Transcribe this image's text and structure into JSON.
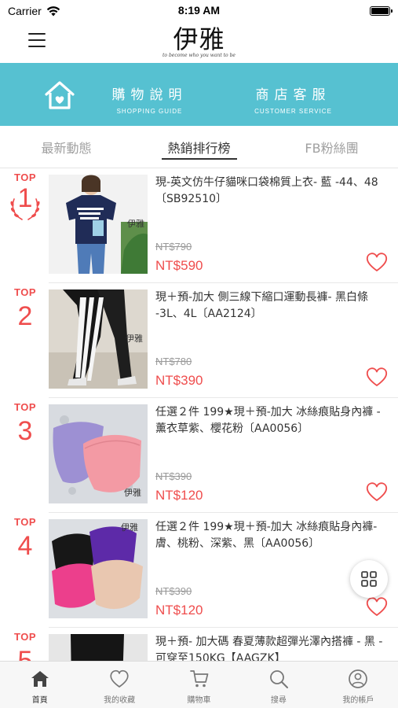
{
  "status_bar": {
    "carrier": "Carrier",
    "time": "8:19 AM",
    "battery_level": 1.0
  },
  "header": {
    "logo_text": "伊雅",
    "logo_tagline": "to become who you want to be"
  },
  "banner": {
    "shopping_guide": {
      "zh": "購物說明",
      "en": "SHOPPING GUIDE"
    },
    "customer_service": {
      "zh": "商店客服",
      "en": "CUSTOMER SERVICE"
    }
  },
  "tabs": [
    {
      "label": "最新動態",
      "active": false
    },
    {
      "label": "熱銷排行榜",
      "active": true
    },
    {
      "label": "FB粉絲團",
      "active": false
    }
  ],
  "products": [
    {
      "rank_label": "TOP",
      "rank": "1",
      "title": "現-英文仿牛仔貓咪口袋棉質上衣- 藍 -44、48〔SB92510〕",
      "old_price": "NT$790",
      "price": "NT$590"
    },
    {
      "rank_label": "TOP",
      "rank": "2",
      "title": "現＋預-加大 側三線下縮口運動長褲- 黑白條 -3L、4L〔AA2124〕",
      "old_price": "NT$780",
      "price": "NT$390"
    },
    {
      "rank_label": "TOP",
      "rank": "3",
      "title": "任選２件 199★現＋預-加大 冰絲痕貼身內褲 - 薰衣草紫、櫻花粉〔AA0056〕",
      "old_price": "NT$390",
      "price": "NT$120"
    },
    {
      "rank_label": "TOP",
      "rank": "4",
      "title": "任選２件 199★現＋預-加大 冰絲痕貼身內褲- 膚、桃粉、深紫、黑〔AA0056〕",
      "old_price": "NT$390",
      "price": "NT$120"
    },
    {
      "rank_label": "TOP",
      "rank": "5",
      "title": "現＋預- 加大碼 春夏薄款超彈光澤內搭褲 - 黑 -可穿至150KG【AAGZK】",
      "old_price": "",
      "price": ""
    }
  ],
  "watermark": "伊雅",
  "tab_bar": [
    {
      "label": "首頁",
      "icon": "home-icon",
      "active": true
    },
    {
      "label": "我的收藏",
      "icon": "heart-icon",
      "active": false
    },
    {
      "label": "購物車",
      "icon": "cart-icon",
      "active": false
    },
    {
      "label": "搜尋",
      "icon": "search-icon",
      "active": false
    },
    {
      "label": "我的帳戶",
      "icon": "account-icon",
      "active": false
    }
  ],
  "colors": {
    "accent_teal": "#56c1d1",
    "price_red": "#ef4d4d"
  }
}
